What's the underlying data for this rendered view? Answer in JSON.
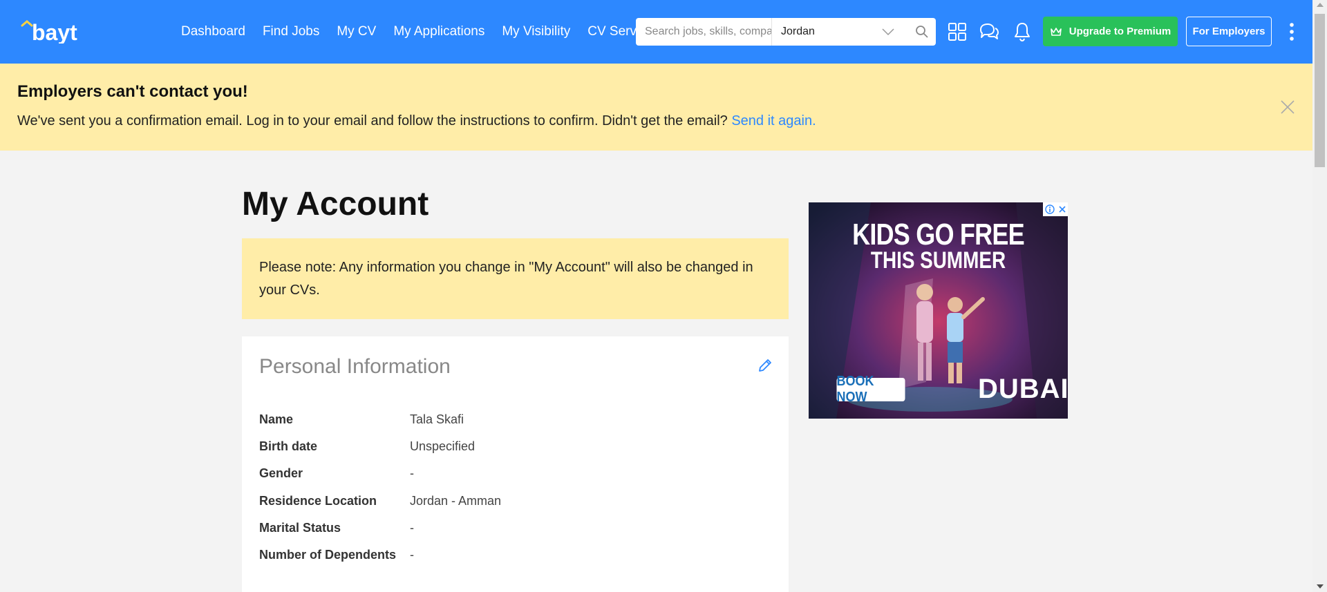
{
  "header": {
    "logo_text": "bayt",
    "nav": [
      "Dashboard",
      "Find Jobs",
      "My CV",
      "My Applications",
      "My Visibility",
      "CV Services"
    ],
    "search_placeholder": "Search jobs, skills, companies",
    "location": "Jordan",
    "upgrade_label": "Upgrade to Premium",
    "employers_label": "For Employers",
    "colors": {
      "primary": "#2d88ff",
      "upgrade": "#29c15a"
    }
  },
  "banner": {
    "title": "Employers can't contact you!",
    "text": "We've sent you a confirmation email. Log in to your email and follow the instructions to confirm. Didn't get the email?",
    "link": "Send it again.",
    "background": "#ffeda8"
  },
  "main": {
    "title": "My Account",
    "note": "Please note: Any information you change in \"My Account\" will also be changed in your CVs."
  },
  "personal_info": {
    "title": "Personal Information",
    "rows": [
      {
        "label": "Name",
        "value": "Tala Skafi"
      },
      {
        "label": "Birth date",
        "value": "Unspecified"
      },
      {
        "label": "Gender",
        "value": "-"
      },
      {
        "label": "Residence Location",
        "value": "Jordan - Amman"
      },
      {
        "label": "Marital Status",
        "value": "-"
      },
      {
        "label": "Number of Dependents",
        "value": "-"
      }
    ]
  },
  "ad": {
    "line1": "KIDS GO FREE",
    "line2": "THIS SUMMER",
    "cta": "BOOK NOW",
    "brand": "DUBAI"
  }
}
